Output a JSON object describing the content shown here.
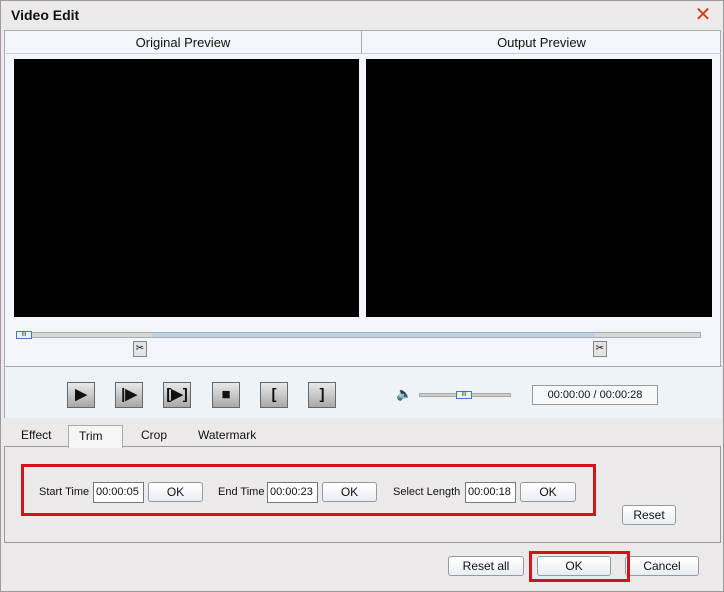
{
  "window": {
    "title": "Video Edit"
  },
  "preview": {
    "original_label": "Original Preview",
    "output_label": "Output Preview"
  },
  "playback": {
    "time": "00:00:00 / 00:00:28",
    "volume_percent": 40,
    "position_percent": 0
  },
  "tabs": [
    "Effect",
    "Trim",
    "Crop",
    "Watermark"
  ],
  "trim": {
    "start_label": "Start Time",
    "start_value": "00:00:05",
    "end_label": "End Time",
    "end_value": "00:00:23",
    "length_label": "Select Length",
    "length_value": "00:00:18",
    "ok_label": "OK",
    "reset_label": "Reset"
  },
  "footer": {
    "reset_all": "Reset all",
    "ok": "OK",
    "cancel": "Cancel"
  }
}
